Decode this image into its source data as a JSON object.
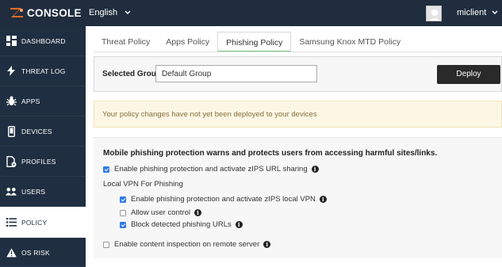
{
  "header": {
    "logo_text": "CONSOLE",
    "language": "English",
    "username": "miclient"
  },
  "sidebar": {
    "items": [
      {
        "label": "DASHBOARD",
        "icon": "dashboard-icon"
      },
      {
        "label": "THREAT LOG",
        "icon": "bolt-icon"
      },
      {
        "label": "APPS",
        "icon": "bug-icon"
      },
      {
        "label": "DEVICES",
        "icon": "mobile-icon"
      },
      {
        "label": "PROFILES",
        "icon": "profile-file-icon"
      },
      {
        "label": "USERS",
        "icon": "users-icon"
      },
      {
        "label": "POLICY",
        "icon": "list-icon",
        "active": true
      },
      {
        "label": "OS RISK",
        "icon": "warning-icon"
      }
    ]
  },
  "tabs": [
    {
      "label": "Threat Policy"
    },
    {
      "label": "Apps Policy"
    },
    {
      "label": "Phishing Policy",
      "active": true
    },
    {
      "label": "Samsung Knox MTD Policy"
    }
  ],
  "group": {
    "label": "Selected Group",
    "value": "Default Group",
    "deploy_label": "Deploy"
  },
  "alert": {
    "text": "Your policy changes have not yet been deployed to your devices"
  },
  "settings": {
    "heading": "Mobile phishing protection warns and protects users from accessing harmful sites/links.",
    "options": {
      "url_sharing": {
        "label": "Enable phishing protection and activate zIPS URL sharing",
        "checked": true
      },
      "local_vpn_heading": "Local VPN For Phishing",
      "local_vpn": {
        "label": "Enable phishing protection and activate zIPS local VPN",
        "checked": true
      },
      "user_control": {
        "label": "Allow user control",
        "checked": false
      },
      "block_urls": {
        "label": "Block detected phishing URLs",
        "checked": true
      },
      "content_inspection": {
        "label": "Enable content inspection on remote server",
        "checked": false
      }
    }
  },
  "colors": {
    "topbar": "#1f2d3e",
    "sidebar": "#1f2e40",
    "accent_tab": "#7dc47e",
    "checkbox": "#2f7ae5",
    "logo_orange": "#f26b21"
  }
}
